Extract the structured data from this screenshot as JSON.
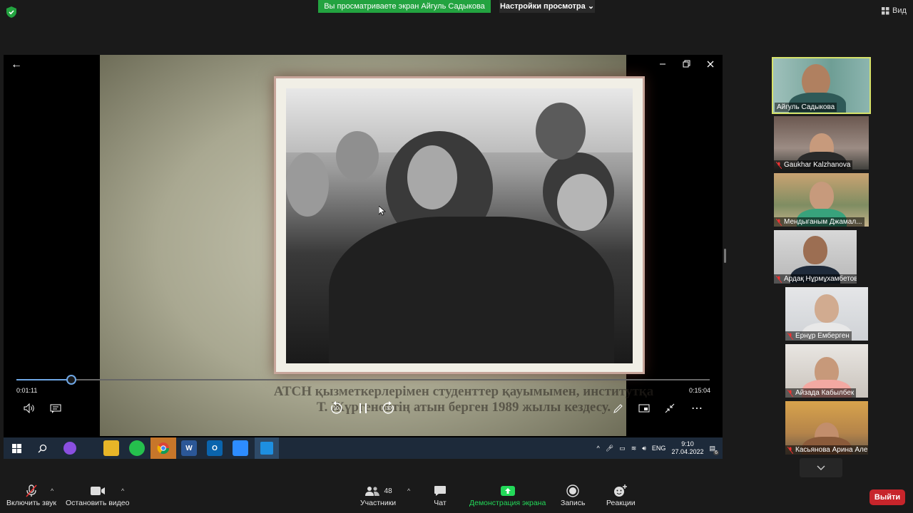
{
  "top_bar": {
    "banner_text": "Вы просматриваете экран Айгуль Садыкова",
    "view_options_label": "Настройки просмотра",
    "view_label": "Вид"
  },
  "player": {
    "time_current": "0:01:11",
    "time_total": "0:15:04",
    "progress_fraction": 0.079,
    "subtitle_line1": "АТСН қызметкерлерімен студенттер қауымымен, институтқа",
    "subtitle_line2": "Т. Жүргеновтің атын берген 1989 жылы кездесу.",
    "skip_back_label": "10",
    "skip_forward_label": "30"
  },
  "taskbar": {
    "language": "ENG",
    "time": "9:10",
    "date": "27.04.2022",
    "notifications_count": "6"
  },
  "participants": [
    {
      "name": "Айгуль Садыкова",
      "muted": false,
      "active": true
    },
    {
      "name": "Gaukhar Kalzhanova",
      "muted": true
    },
    {
      "name": "Мендыганым Джамал...",
      "muted": true
    },
    {
      "name": "Ардақ Нұрмұхамбетов",
      "muted": true
    },
    {
      "name": "Ернұр Емберген",
      "muted": true
    },
    {
      "name": "Айзада Кабылбек",
      "muted": true
    },
    {
      "name": "Касьянова Арина Але...",
      "muted": true
    }
  ],
  "toolbar": {
    "unmute_label": "Включить звук",
    "stop_video_label": "Остановить видео",
    "participants_label": "Участники",
    "participants_count": "48",
    "chat_label": "Чат",
    "share_label": "Демонстрация экрана",
    "record_label": "Запись",
    "reactions_label": "Реакции",
    "leave_label": "Выйти"
  },
  "colors": {
    "banner_green": "#23a340",
    "share_green": "#23d959",
    "leave_red": "#c7252b",
    "active_border": "#d6e26a",
    "seek_blue": "#6fa7e5"
  }
}
